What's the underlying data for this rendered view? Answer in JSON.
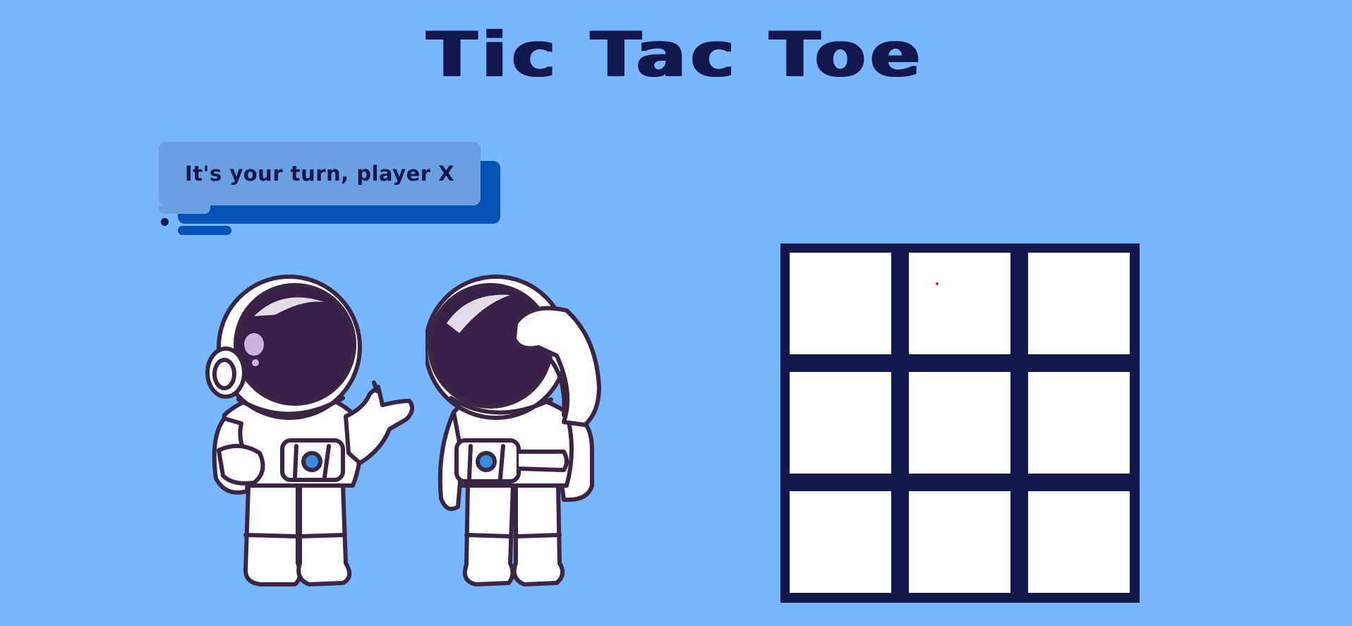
{
  "game": {
    "title": "Tic Tac Toe",
    "status_message": "It's your turn, player X"
  },
  "board": {
    "cells": [
      "",
      "",
      "",
      "",
      "",
      "",
      "",
      "",
      ""
    ]
  },
  "illustration": {
    "left_astronaut": "astronaut-pointing-icon",
    "right_astronaut": "astronaut-thinking-icon"
  },
  "colors": {
    "background": "#78b7fd",
    "title": "#13174e",
    "board_frame": "#13174e",
    "cell": "#ffffff",
    "bubble_front": "#6aa0e0",
    "bubble_back": "#0552b5"
  }
}
